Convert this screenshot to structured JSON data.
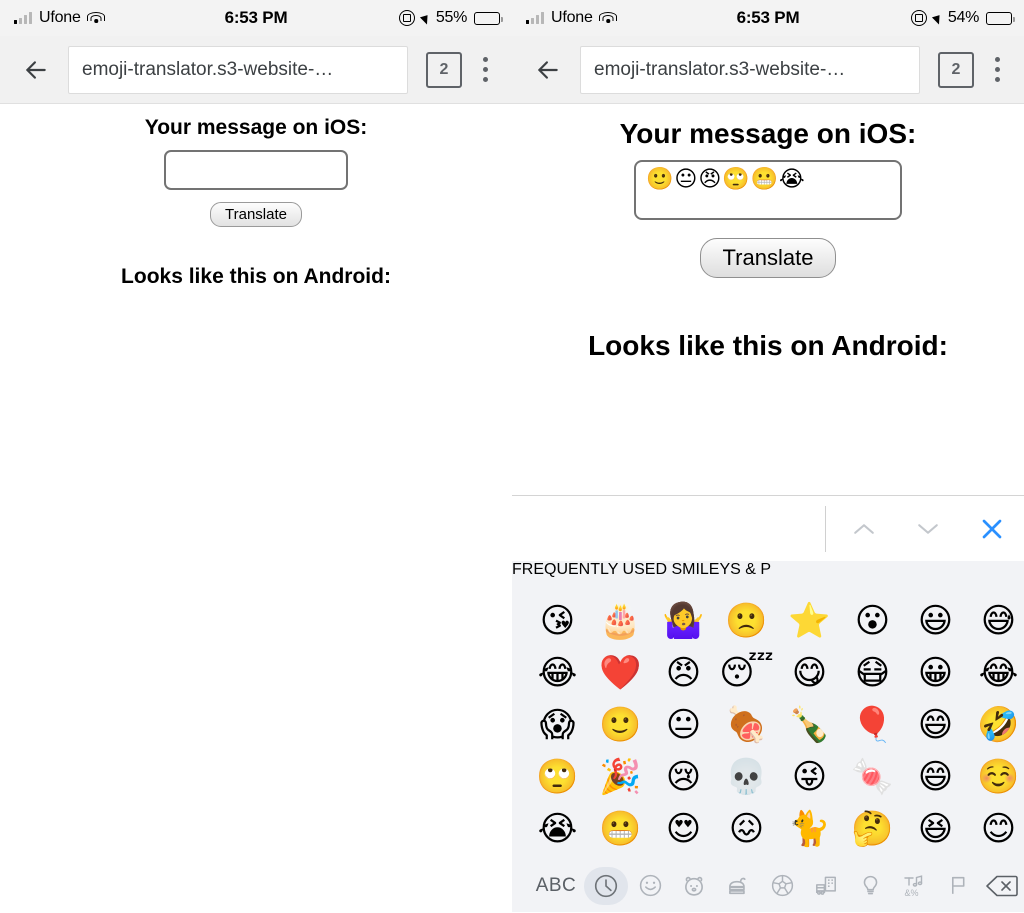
{
  "panels": {
    "left": {
      "status": {
        "carrier": "Ufone",
        "time": "6:53 PM",
        "battery_pct": "55%",
        "signal_icon": "cellular-bars-icon",
        "wifi_icon": "wifi-icon",
        "rotation_lock_icon": "rotation-lock-icon",
        "location_icon": "location-arrow-icon",
        "battery_icon": "battery-icon"
      },
      "browser": {
        "back_icon": "back-arrow-icon",
        "url": "emoji-translator.s3-website-…",
        "tab_count": "2",
        "menu_icon": "kebab-menu-icon"
      },
      "page": {
        "heading_ios": "Your message on iOS:",
        "input_value": "",
        "input_placeholder": "",
        "translate_label": "Translate",
        "heading_android": "Looks like this on Android:"
      }
    },
    "right": {
      "status": {
        "carrier": "Ufone",
        "time": "6:53 PM",
        "battery_pct": "54%",
        "signal_icon": "cellular-bars-icon",
        "wifi_icon": "wifi-icon",
        "rotation_lock_icon": "rotation-lock-icon",
        "location_icon": "location-arrow-icon",
        "battery_icon": "battery-icon"
      },
      "browser": {
        "back_icon": "back-arrow-icon",
        "url": "emoji-translator.s3-website-…",
        "tab_count": "2",
        "menu_icon": "kebab-menu-icon"
      },
      "page": {
        "heading_ios": "Your message on iOS:",
        "input_value": "🙂😐😠🙄😬😭",
        "input_placeholder": "",
        "translate_label": "Translate",
        "heading_android": "Looks like this on Android:"
      }
    }
  },
  "keyboard": {
    "accessory": {
      "prev_icon": "chevron-up-icon",
      "next_icon": "chevron-down-icon",
      "close_icon": "close-x-icon",
      "close_color": "#2a90ff",
      "chevron_color": "#c3c7cc"
    },
    "categories": {
      "frequently_used": "FREQUENTLY USED",
      "smileys": "SMILEYS & P"
    },
    "grid": {
      "rows": [
        [
          "😘",
          "🎂",
          "🤷‍♀️",
          "🙁",
          "⭐",
          "😮",
          "😃",
          "😅"
        ],
        [
          "😂",
          "❤️",
          "😠",
          "😴",
          "😋",
          "😷",
          "😀",
          "😂"
        ],
        [
          "😱",
          "🙂",
          "😐",
          "🍖",
          "🍾",
          "🎈",
          "😄",
          "🤣"
        ],
        [
          "🙄",
          "🎉",
          "😢",
          "💀",
          "😜",
          "🍬",
          "😄",
          "☺️"
        ],
        [
          "😭",
          "😬",
          "😍",
          "😖",
          "🐈",
          "🤔",
          "😆",
          "😊"
        ]
      ]
    },
    "bottom_bar": {
      "abc_label": "ABC",
      "items": [
        "clock-recent-icon",
        "smiley-icon",
        "animals-icon",
        "food-icon",
        "sports-icon",
        "travel-icon",
        "objects-lightbulb-icon",
        "symbols-icon",
        "flag-icon"
      ],
      "backspace_icon": "backspace-icon",
      "selected_index": 0
    }
  }
}
